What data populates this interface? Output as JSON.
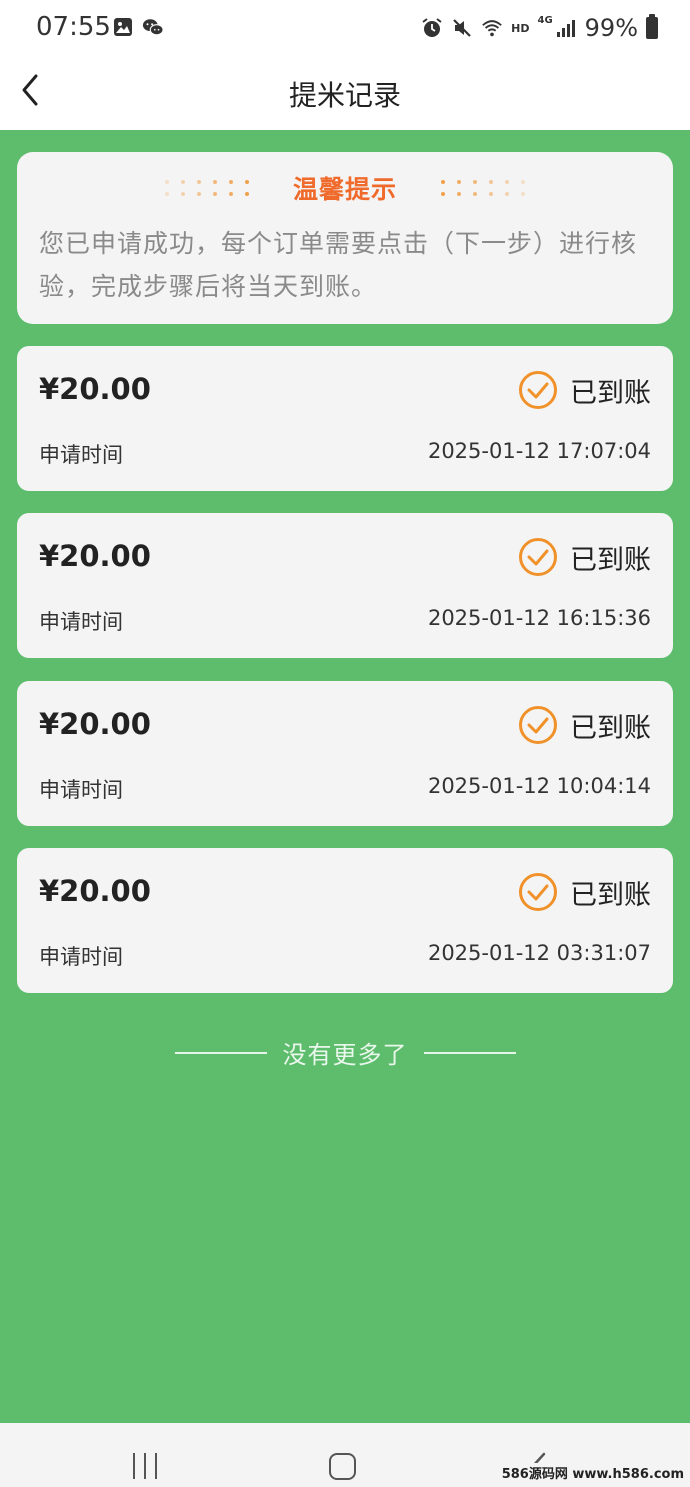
{
  "status_bar": {
    "time": "07:55",
    "hd": "HD",
    "network": "4G",
    "battery": "99%",
    "icons": [
      "gallery-icon",
      "wechat-icon",
      "alarm-icon",
      "mute-icon",
      "wifi-icon",
      "signal-icon",
      "battery-icon"
    ]
  },
  "nav": {
    "title": "提米记录",
    "back_icon": "chevron-left-icon"
  },
  "tip": {
    "title": "温馨提示",
    "text": "您已申请成功，每个订单需要点击（下一步）进行核验，完成步骤后将当天到账。"
  },
  "records": [
    {
      "amount": "¥20.00",
      "status": "已到账",
      "label": "申请时间",
      "time": "2025-01-12 17:07:04"
    },
    {
      "amount": "¥20.00",
      "status": "已到账",
      "label": "申请时间",
      "time": "2025-01-12 16:15:36"
    },
    {
      "amount": "¥20.00",
      "status": "已到账",
      "label": "申请时间",
      "time": "2025-01-12 10:04:14"
    },
    {
      "amount": "¥20.00",
      "status": "已到账",
      "label": "申请时间",
      "time": "2025-01-12 03:31:07"
    }
  ],
  "end_text": "没有更多了",
  "colors": {
    "background": "#5dbd6c",
    "card": "#f4f4f4",
    "accent_orange": "#f06a2b",
    "check_orange": "#f0912a"
  },
  "watermark": "586源码网 www.h586.com"
}
